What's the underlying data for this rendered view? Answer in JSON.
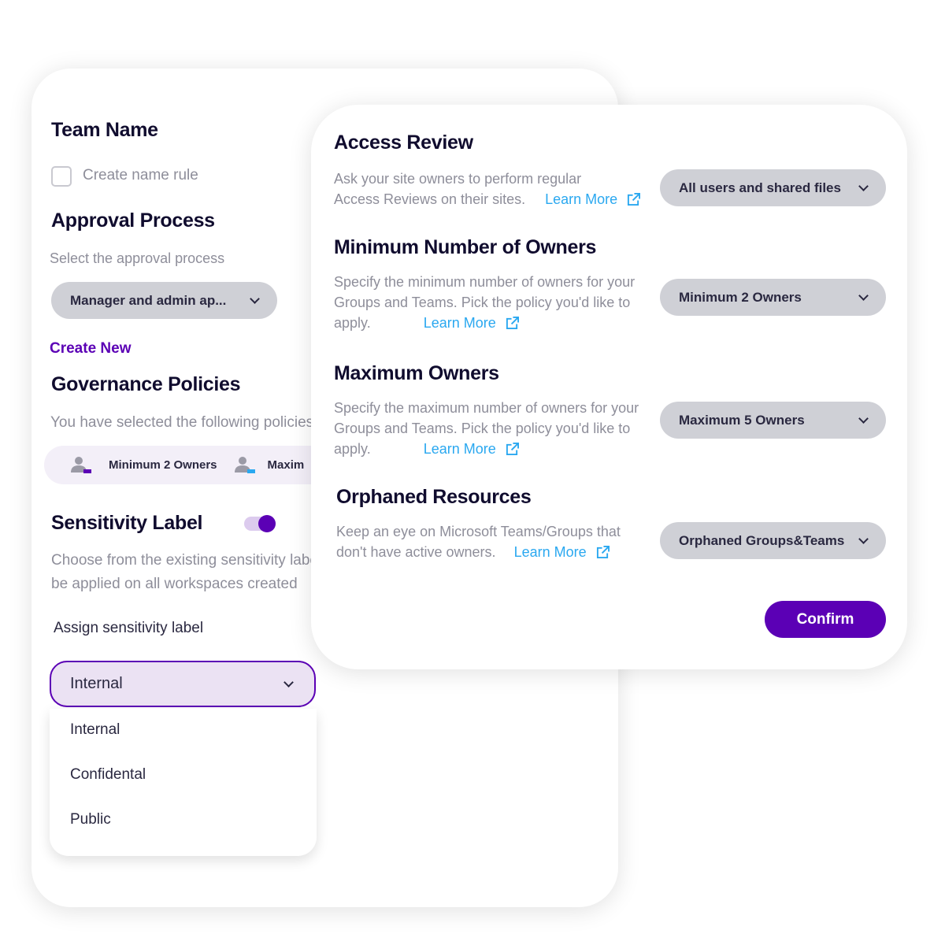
{
  "left": {
    "team_name": {
      "title": "Team Name",
      "checkbox_label": "Create name rule",
      "checked": false
    },
    "approval": {
      "title": "Approval Process",
      "subtitle": "Select the approval process",
      "selected": "Manager and admin ap...",
      "create_new": "Create New"
    },
    "governance": {
      "title": "Governance Policies",
      "subtitle": "You have selected the following policies",
      "chips": [
        {
          "label": "Minimum 2 Owners",
          "icon": "user-icon",
          "color": "#5b00b5"
        },
        {
          "label": "Maxim",
          "icon": "user-icon",
          "color": "#2aa8f0"
        }
      ]
    },
    "sensitivity": {
      "title": "Sensitivity Label",
      "toggle_on": true,
      "description_1": "Choose from the existing sensitivity labe",
      "description_2": "be applied on all workspaces created",
      "assign_label": "Assign sensitivity label",
      "selected": "Internal",
      "options": [
        "Internal",
        "Confidental",
        "Public"
      ]
    }
  },
  "right": {
    "sections": [
      {
        "title": "Access Review",
        "desc": [
          "Ask your site owners to perform regular",
          "Access Reviews on their sites."
        ],
        "link": "Learn More",
        "select": "All users and shared files"
      },
      {
        "title": "Minimum Number of Owners",
        "desc": [
          "Specify the minimum number of owners for your",
          "Groups and Teams. Pick the policy you'd like to",
          "apply."
        ],
        "link": "Learn More",
        "select": "Minimum 2 Owners"
      },
      {
        "title": "Maximum Owners",
        "desc": [
          "Specify the maximum number of owners for your",
          "Groups and Teams. Pick the policy you'd like to",
          "apply."
        ],
        "link": "Learn More",
        "select": "Maximum 5 Owners"
      },
      {
        "title": "Orphaned Resources",
        "desc": [
          "Keep an eye on Microsoft Teams/Groups that",
          "don't have active owners."
        ],
        "link": "Learn More",
        "select": "Orphaned Groups&Teams"
      }
    ],
    "confirm": "Confirm"
  },
  "colors": {
    "accent": "#5b00b5",
    "link": "#2aa8f0",
    "pill": "#cfd0d6"
  }
}
